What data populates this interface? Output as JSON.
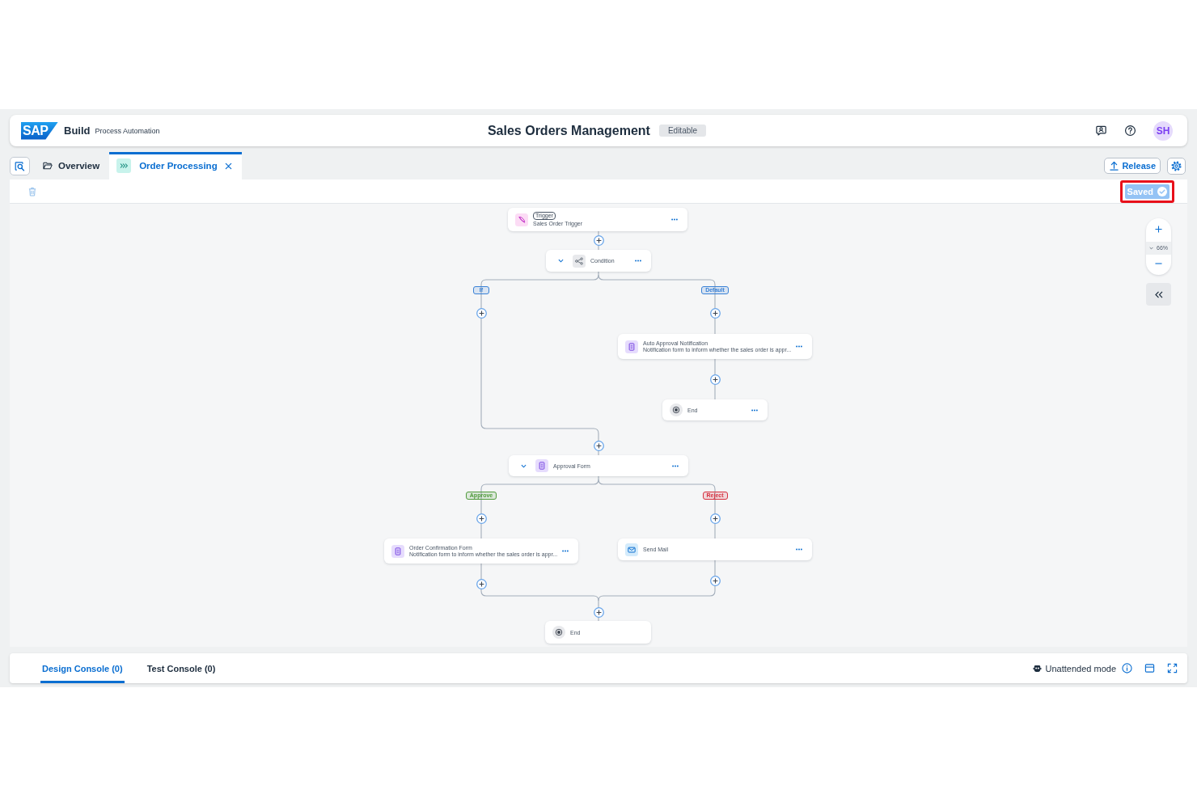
{
  "header": {
    "logo": "SAP",
    "product": "Build",
    "product_subtitle": "Process Automation",
    "project_title": "Sales Orders Management",
    "status_badge": "Editable",
    "avatar_initials": "SH"
  },
  "tabs": [
    {
      "kind": "overview",
      "label": "Overview",
      "selected": false,
      "closable": false
    },
    {
      "kind": "process",
      "label": "Order Processing",
      "selected": true,
      "closable": true
    }
  ],
  "actions": {
    "release": "Release"
  },
  "toolbar": {
    "delete_disabled": true,
    "saved": "Saved",
    "saved_highlighted": true
  },
  "canvas": {
    "nodes": [
      {
        "kind": "trigger",
        "tag": "Trigger",
        "title": "Sales Order Trigger",
        "expanded": false,
        "menu": true
      },
      {
        "kind": "condition",
        "title": "Condition",
        "expanded": true,
        "menu": true
      },
      {
        "kind": "form",
        "title": "Auto Approval Notification",
        "description": "Notification form to inform whether the sales order is appr...",
        "expanded": false,
        "menu": true
      },
      {
        "kind": "end",
        "title": "End",
        "expanded": false,
        "menu": true
      },
      {
        "kind": "form",
        "title": "Approval Form",
        "expanded": true,
        "menu": true
      },
      {
        "kind": "form",
        "title": "Order Confirmation Form",
        "description": "Notification form to inform whether the sales order is appr...",
        "expanded": false,
        "menu": true
      },
      {
        "kind": "mail",
        "title": "Send Mail",
        "expanded": false,
        "menu": true
      },
      {
        "kind": "end",
        "title": "End",
        "expanded": false,
        "menu": false
      }
    ],
    "branch_labels": [
      {
        "label": "If",
        "color": "#3a82d6"
      },
      {
        "label": "Default",
        "color": "#3a82d6"
      },
      {
        "label": "Approve",
        "color": "#4f9a3a"
      },
      {
        "label": "Reject",
        "color": "#d6303f"
      }
    ],
    "zoom": "66%"
  },
  "console": {
    "tabs": [
      {
        "label": "Design Console (0)",
        "selected": true
      },
      {
        "label": "Test Console (0)",
        "selected": false
      }
    ],
    "mode": "Unattended mode"
  }
}
